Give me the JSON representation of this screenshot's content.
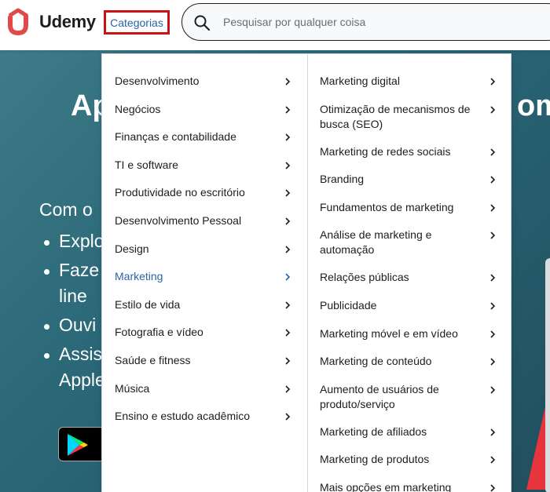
{
  "header": {
    "logo_text": "Udemy",
    "categories_label": "Categorias",
    "search_placeholder": "Pesquisar por qualquer coisa"
  },
  "hero": {
    "title_left": "Ap",
    "title_right": "om",
    "subtitle": "Com o",
    "bullets": [
      "Explo",
      "Faze",
      "line",
      "Ouvi",
      "Assis",
      "Apple"
    ],
    "store_badge": "Google Play"
  },
  "categories_menu": {
    "main": [
      {
        "label": "Desenvolvimento"
      },
      {
        "label": "Negócios"
      },
      {
        "label": "Finanças e contabilidade"
      },
      {
        "label": "TI e software"
      },
      {
        "label": "Produtividade no escritório"
      },
      {
        "label": "Desenvolvimento Pessoal"
      },
      {
        "label": "Design"
      },
      {
        "label": "Marketing",
        "active": true
      },
      {
        "label": "Estilo de vida"
      },
      {
        "label": "Fotografia e vídeo"
      },
      {
        "label": "Saúde e fitness"
      },
      {
        "label": "Música"
      },
      {
        "label": "Ensino e estudo acadêmico"
      }
    ],
    "sub": [
      {
        "label": "Marketing digital"
      },
      {
        "label": "Otimização de mecanismos de busca (SEO)"
      },
      {
        "label": "Marketing de redes sociais"
      },
      {
        "label": "Branding"
      },
      {
        "label": "Fundamentos de marketing"
      },
      {
        "label": "Análise de marketing e automação"
      },
      {
        "label": "Relações públicas"
      },
      {
        "label": "Publicidade"
      },
      {
        "label": "Marketing móvel e em vídeo"
      },
      {
        "label": "Marketing de conteúdo"
      },
      {
        "label": "Aumento de usuários de produto/serviço"
      },
      {
        "label": "Marketing de afiliados"
      },
      {
        "label": "Marketing de produtos"
      },
      {
        "label": "Mais opções em marketing"
      }
    ]
  },
  "colors": {
    "brand": "#a435f0",
    "logo_red": "#a4171d",
    "link_blue": "#2a64a8",
    "highlight_border": "#c81414",
    "hero_bg": "#2a6878"
  }
}
